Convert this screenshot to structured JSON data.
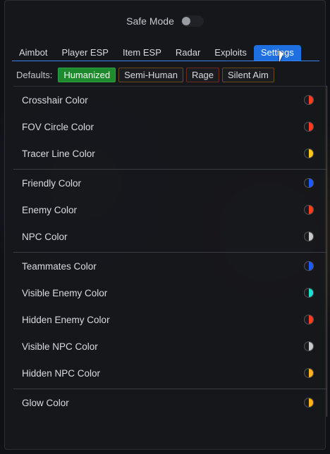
{
  "header": {
    "safe_mode_label": "Safe Mode",
    "safe_mode_on": false
  },
  "tabs": [
    {
      "label": "Aimbot",
      "active": false
    },
    {
      "label": "Player ESP",
      "active": false
    },
    {
      "label": "Item ESP",
      "active": false
    },
    {
      "label": "Radar",
      "active": false
    },
    {
      "label": "Exploits",
      "active": false
    },
    {
      "label": "Settings",
      "active": true
    }
  ],
  "defaults": {
    "label": "Defaults:",
    "presets": [
      {
        "label": "Humanized",
        "active": true
      },
      {
        "label": "Semi-Human",
        "active": false
      },
      {
        "label": "Rage",
        "active": false
      },
      {
        "label": "Silent Aim",
        "active": false
      }
    ]
  },
  "colors": {
    "accent": "#1e6fe0",
    "humanized_green": "#1e8a2e"
  },
  "groups": [
    [
      {
        "label": "Crosshair Color",
        "color": "#ff3b1f",
        "icon": "color-swatch-icon"
      },
      {
        "label": "FOV Circle Color",
        "color": "#ff3b1f",
        "icon": "color-swatch-icon"
      },
      {
        "label": "Tracer Line Color",
        "color": "#ffc61a",
        "icon": "color-swatch-icon"
      }
    ],
    [
      {
        "label": "Friendly Color",
        "color": "#1e5bff",
        "icon": "color-swatch-icon"
      },
      {
        "label": "Enemy Color",
        "color": "#ff3b1f",
        "icon": "color-swatch-icon"
      },
      {
        "label": "NPC Color",
        "color": "#c8c8c8",
        "icon": "color-swatch-icon"
      }
    ],
    [
      {
        "label": "Teammates Color",
        "color": "#1e5bff",
        "icon": "color-swatch-icon"
      },
      {
        "label": "Visible Enemy Color",
        "color": "#1ee0d0",
        "icon": "color-swatch-icon"
      },
      {
        "label": "Hidden Enemy Color",
        "color": "#ff3b1f",
        "icon": "color-swatch-icon"
      },
      {
        "label": "Visible NPC Color",
        "color": "#c8c8c8",
        "icon": "color-swatch-icon"
      },
      {
        "label": "Hidden NPC Color",
        "color": "#ffb21a",
        "icon": "color-swatch-icon"
      }
    ],
    [
      {
        "label": "Glow Color",
        "color": "#ffb21a",
        "icon": "color-swatch-icon"
      }
    ]
  ]
}
